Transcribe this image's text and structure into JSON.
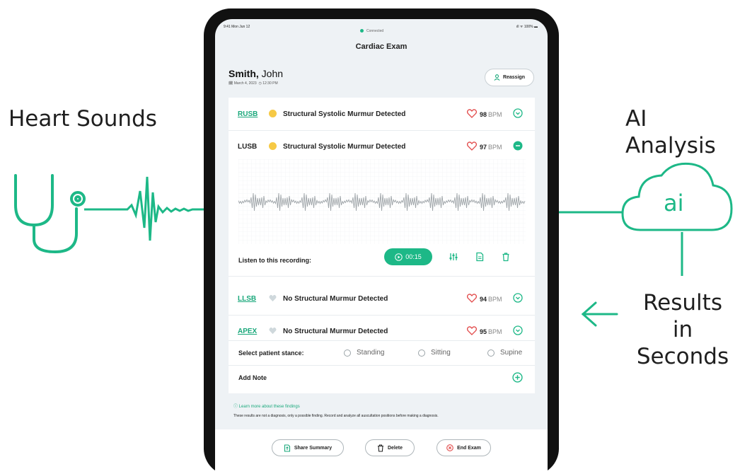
{
  "labels": {
    "heart_sounds": "Heart Sounds",
    "ai_analysis": "AI Analysis",
    "ai_badge": "ai",
    "results_line1": "Results in",
    "results_line2": "Seconds"
  },
  "status_bar": {
    "time": "9:41 Mon Jun 12",
    "system": "ıll ᯤ 100% ▬",
    "connection": "Connected"
  },
  "header": {
    "title": "Cardiac Exam"
  },
  "patient": {
    "last_name": "Smith,",
    "first_name": "John",
    "date": "🗓 March 4, 2023",
    "time": "◷ 12:30 PM",
    "reassign_label": "Reassign"
  },
  "results": [
    {
      "location": "RUSB",
      "finding": "Structural Systolic Murmur Detected",
      "bpm": "98",
      "bpm_unit": "BPM",
      "status_color": "#f6c945",
      "expanded": false
    },
    {
      "location": "LUSB",
      "finding": "Structural Systolic Murmur Detected",
      "bpm": "97",
      "bpm_unit": "BPM",
      "status_color": "#f6c945",
      "expanded": true
    },
    {
      "location": "LLSB",
      "finding": "No Structural Murmur Detected",
      "bpm": "94",
      "bpm_unit": "BPM",
      "status_color": "#cfd8dc",
      "expanded": false
    },
    {
      "location": "APEX",
      "finding": "No Structural Murmur Detected",
      "bpm": "95",
      "bpm_unit": "BPM",
      "status_color": "#cfd8dc",
      "expanded": false
    }
  ],
  "recording": {
    "listen_label": "Listen to this recording:",
    "duration": "00:15"
  },
  "stance": {
    "label": "Select patient stance:",
    "options": [
      "Standing",
      "Sitting",
      "Supine"
    ]
  },
  "note": {
    "label": "Add Note"
  },
  "info": {
    "learn_more": "ⓘ Learn more about these findings",
    "disclaimer": "These results are not a diagnosis, only a possible finding. Record and analyze all auscultation positions before making a diagnosis."
  },
  "actions": {
    "share": "Share Summary",
    "delete": "Delete",
    "end": "End Exam"
  },
  "colors": {
    "accent": "#1db887",
    "warning": "#f6c945",
    "heart": "#e24b4b"
  }
}
